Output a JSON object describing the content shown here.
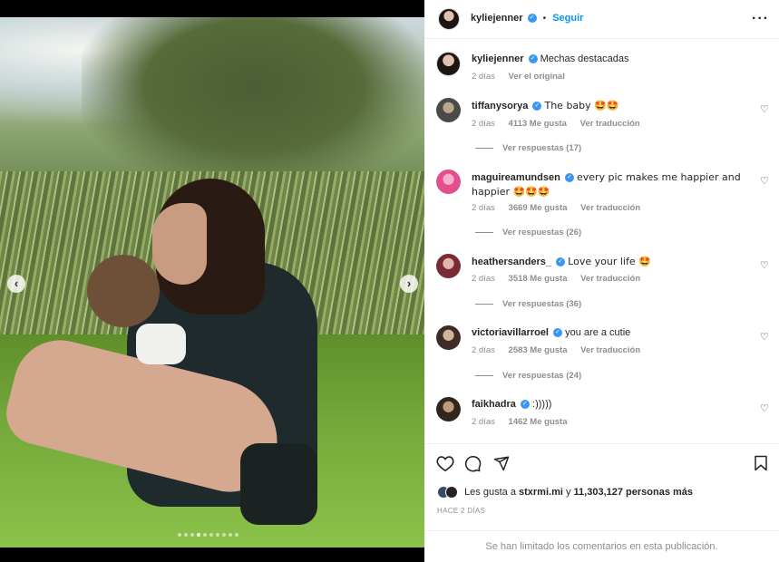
{
  "post": {
    "author": "kyliejenner",
    "follow_label": "Seguir",
    "more_label": "···",
    "caption": "Mechas destacadas",
    "caption_age": "2 días",
    "see_original": "Ver el original"
  },
  "media": {
    "prev_label": "‹",
    "next_label": "›",
    "dot_count": 10,
    "active_dot": 3
  },
  "comments": [
    {
      "user": "tiffanysorya",
      "text": "The baby 🤩🤩",
      "age": "2 días",
      "likes": "4113 Me gusta",
      "translate": "Ver traducción",
      "replies": "Ver respuestas (17)"
    },
    {
      "user": "maguireamundsen",
      "text": "every pic makes me happier and happier 🤩🤩🤩",
      "age": "2 días",
      "likes": "3669 Me gusta",
      "translate": "Ver traducción",
      "replies": "Ver respuestas (26)"
    },
    {
      "user": "heathersanders_",
      "text": "Love your life 🤩",
      "age": "2 días",
      "likes": "3518 Me gusta",
      "translate": "Ver traducción",
      "replies": "Ver respuestas (36)"
    },
    {
      "user": "victoriavillarroel",
      "text": "you are a cutie",
      "age": "2 días",
      "likes": "2583 Me gusta",
      "translate": "Ver traducción",
      "replies": "Ver respuestas (24)"
    },
    {
      "user": "faikhadra",
      "text": ":)))))",
      "age": "2 días",
      "likes": "1462 Me gusta"
    }
  ],
  "actions": {
    "likes_prefix": "Les gusta a",
    "likes_user": "stxrmi.mi",
    "likes_joiner": "y",
    "likes_count": "11,303,127 personas más",
    "time_ago": "HACE 2 DÍAS",
    "comments_limited": "Se han limitado los comentarios en esta publicación."
  },
  "colors": {
    "accent": "#0095f6",
    "verified": "#3897f0",
    "muted": "#8e8e8e"
  }
}
